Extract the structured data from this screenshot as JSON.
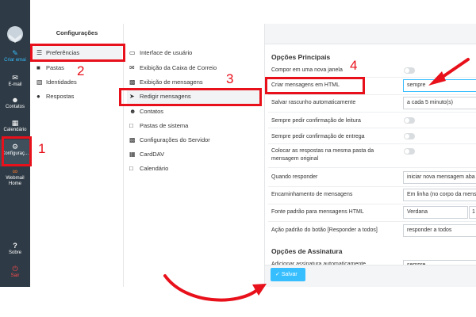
{
  "nav": {
    "compose": "Criar emai",
    "email": "E-mail",
    "contacts": "Contatos",
    "calendar": "Calendário",
    "settings": "Configuraç...",
    "webmail_home": "Webmail Home",
    "help": "Sobre",
    "logout": "Sair"
  },
  "settings_list": {
    "title": "Configurações",
    "items": [
      "Preferências",
      "Pastas",
      "Identidades",
      "Respostas"
    ]
  },
  "sections": [
    "Interface de usuário",
    "Exibição da Caixa de Correio",
    "Exibição de mensagens",
    "Redigir mensagens",
    "Contatos",
    "Pastas de sistema",
    "Configurações do Servidor",
    "CardDAV",
    "Calendário"
  ],
  "form": {
    "main_title": "Opções Principais",
    "rows": [
      {
        "label": "Compor em uma nova janela"
      },
      {
        "label": "Criar mensagens em HTML",
        "value": "sempre"
      },
      {
        "label": "Salvar rascunho automaticamente",
        "value": "a cada 5 minuto(s)"
      },
      {
        "label": "Sempre pedir confirmação de leitura"
      },
      {
        "label": "Sempre pedir confirmação de entrega"
      },
      {
        "label": "Colocar as respostas na mesma pasta da mensagem original"
      },
      {
        "label": "Quando responder",
        "value": "iniciar nova mensagem aba"
      },
      {
        "label": "Encaminhamento de mensagens",
        "value": "Em linha (no corpo da mens"
      },
      {
        "label": "Fonte padrão para mensagens HTML",
        "value": "Verdana",
        "value2": "1"
      },
      {
        "label": "Ação padrão do botão [Responder a todos]",
        "value": "responder a todos"
      }
    ],
    "signature_title": "Opções de Assinatura",
    "signature_partial": "Adicionar assinatura automaticamente",
    "signature_value": "sempre",
    "save_label": "Salvar"
  },
  "annotations": [
    "1",
    "2",
    "3",
    "4"
  ],
  "colors": {
    "annotation": "#e8101a",
    "accent": "#37beff",
    "nav_bg": "#2e3a45"
  }
}
